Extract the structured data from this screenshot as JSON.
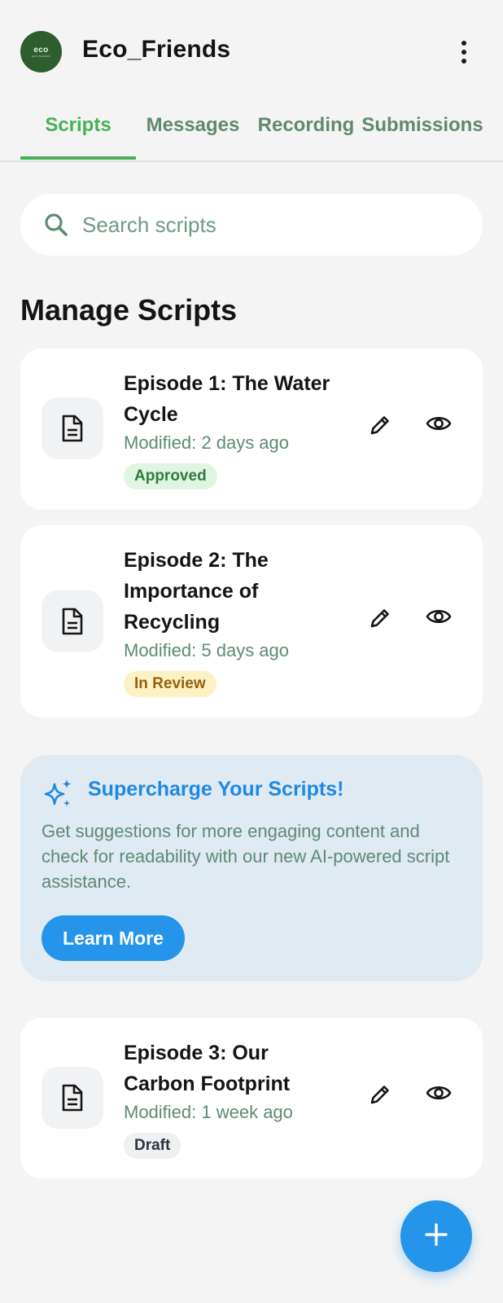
{
  "header": {
    "logo_text": "eco",
    "logo_subtext": "ECO FRIENDS",
    "app_title": "Eco_Friends",
    "menu_icon": "more-vertical-icon"
  },
  "tabs": [
    {
      "label": "Scripts",
      "active": true
    },
    {
      "label": "Messages",
      "active": false
    },
    {
      "label": "Recording",
      "active": false
    },
    {
      "label": "Submissions",
      "active": false
    }
  ],
  "search": {
    "placeholder": "Search scripts",
    "value": "",
    "icon": "search-icon"
  },
  "section_title": "Manage Scripts",
  "scripts": [
    {
      "title": "Episode 1: The Water Cycle",
      "modified": "Modified: 2 days ago",
      "status": "Approved",
      "status_color": "#2d7d3a"
    },
    {
      "title": "Episode 2: The Importance of Recycling",
      "modified": "Modified: 5 days ago",
      "status": "In Review",
      "status_color": "#98600d"
    },
    {
      "title": "Episode 3: Our Carbon Footprint",
      "modified": "Modified: 1 week ago",
      "status": "Draft",
      "status_color": "#2b3440"
    }
  ],
  "promo": {
    "icon": "sparkles-icon",
    "title": "Supercharge Your Scripts!",
    "body": "Get suggestions for more engaging content and check for readability with our new AI-powered script assistance.",
    "button_label": "Learn More"
  },
  "fab": {
    "icon": "plus-icon"
  },
  "colors": {
    "accent_green": "#46b256",
    "accent_blue": "#2495ea",
    "background": "#f4f4f4"
  }
}
